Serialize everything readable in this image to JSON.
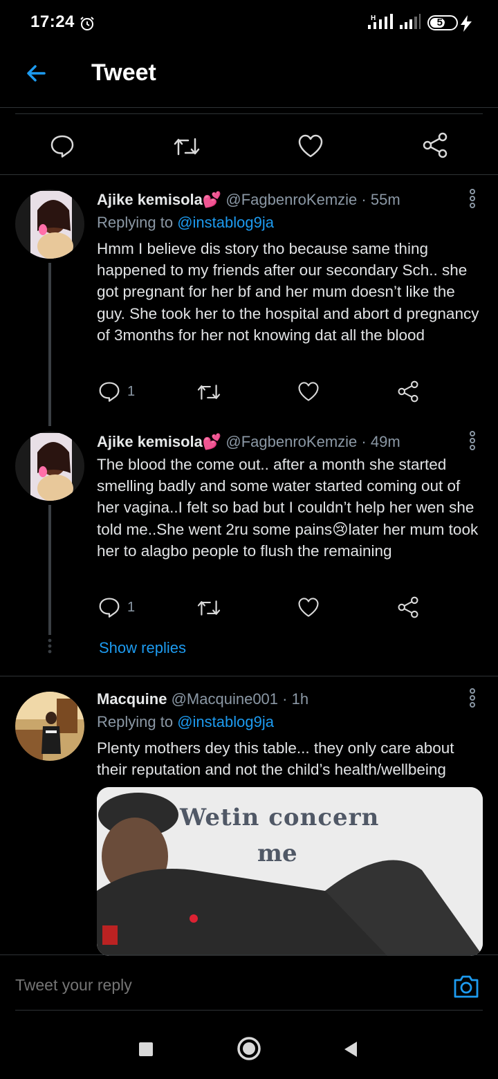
{
  "status_bar": {
    "time": "17:24",
    "battery": "57",
    "battery_level": 0.57,
    "network_label": "H"
  },
  "header": {
    "title": "Tweet"
  },
  "action_bar": {
    "icons": [
      "reply-icon",
      "retweet-icon",
      "like-icon",
      "share-icon"
    ]
  },
  "tweets": [
    {
      "name": "Ajike kemisola",
      "emoji": "💕",
      "handle": "@FagbenroKemzie",
      "time": "· 55m",
      "replying_prefix": "Replying to",
      "replying_to": "@instablog9ja",
      "body": "Hmm I believe dis story tho because same thing happened to my friends after our secondary Sch.. she got pregnant for her bf and her mum doesn’t like the guy. She took her to the hospital and abort d pregnancy of 3months for her not knowing dat all the blood",
      "reply_count": "1"
    },
    {
      "name": "Ajike kemisola",
      "emoji": "💕",
      "handle": "@FagbenroKemzie",
      "time": "· 49m",
      "body": "The blood the come out.. after a month she started smelling badly and some water started coming out of her vagina..I felt so bad but I couldn’t help her wen she told me..She went 2ru some pains😢later her mum took her to alagbo people to flush the remaining",
      "reply_count": "1"
    },
    {
      "name": "Macquine",
      "handle": "@Macquine001",
      "time": "· 1h",
      "replying_prefix": "Replying to",
      "replying_to": "@instablog9ja",
      "body": "Plenty mothers dey this table... they only care about their reputation and not the child’s health/wellbeing",
      "media_caption_line1": "Wetin concern",
      "media_caption_line2": "me"
    }
  ],
  "show_replies": "Show replies",
  "reply_bar": {
    "placeholder": "Tweet your reply"
  },
  "colors": {
    "accent": "#1d9bf0",
    "background": "#000000",
    "divider": "#2f3336",
    "muted": "#8b98a5"
  }
}
